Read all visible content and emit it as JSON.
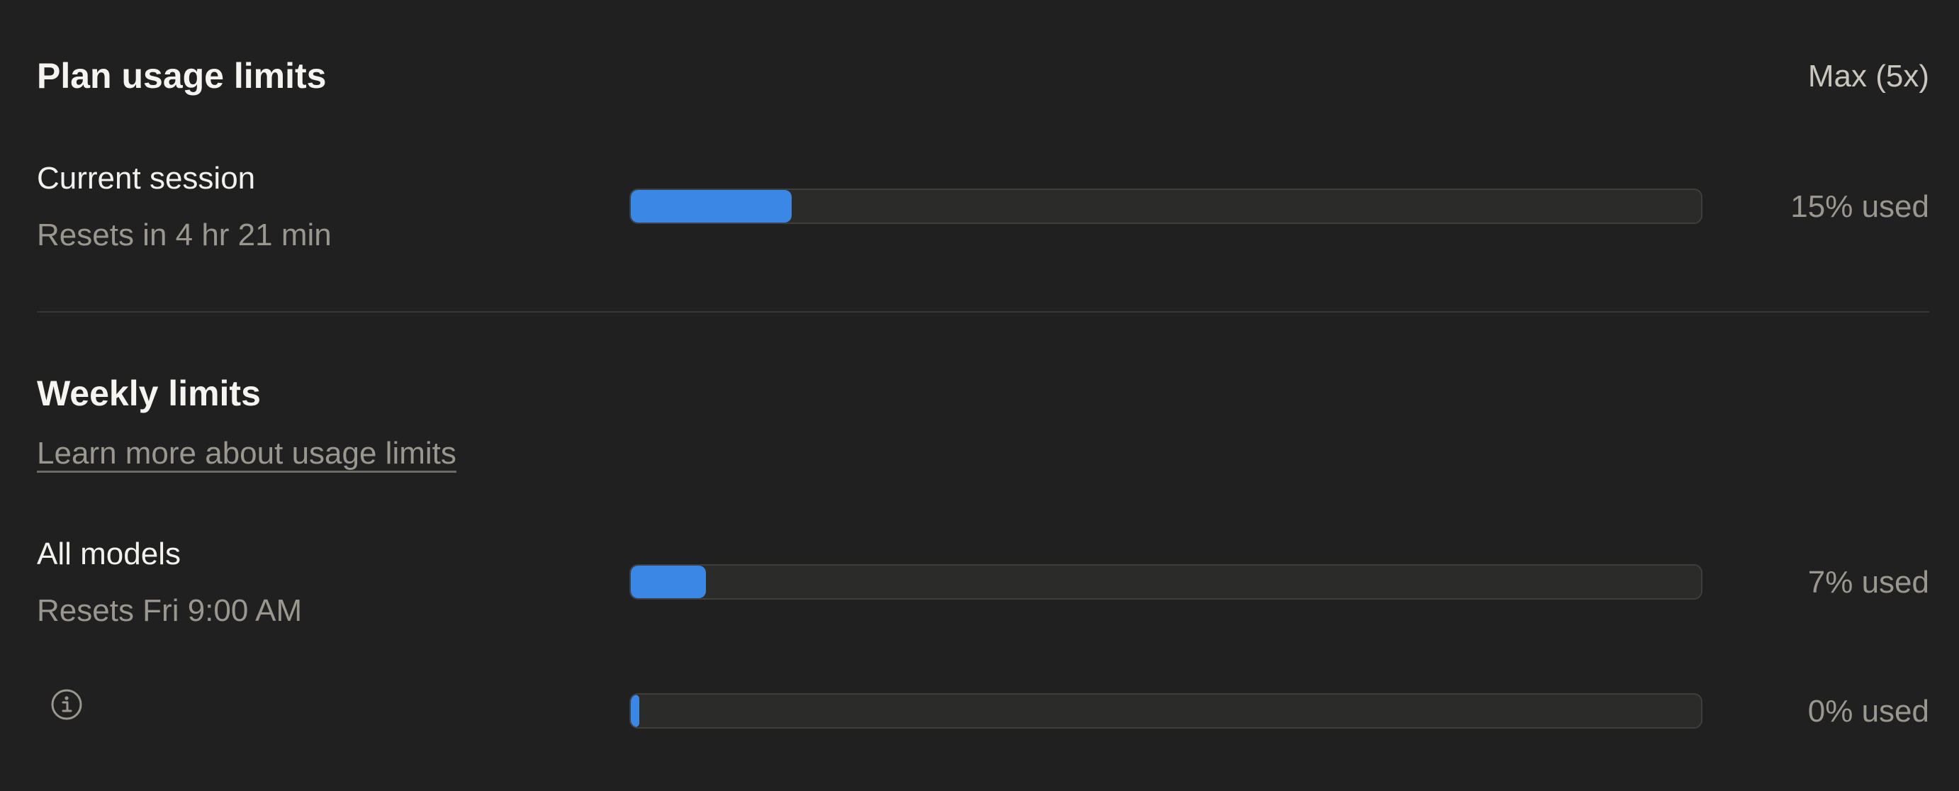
{
  "plan": {
    "title": "Plan usage limits",
    "tier": "Max (5x)"
  },
  "session": {
    "label": "Current session",
    "reset": "Resets in 4 hr 21 min",
    "percent": 15,
    "used_label": "15% used"
  },
  "weekly": {
    "title": "Weekly limits",
    "learn_more": "Learn more about usage limits",
    "rows": [
      {
        "label": "All models",
        "reset": "Resets Fri 9:00 AM",
        "percent": 7,
        "used_label": "7% used"
      },
      {
        "icon": "info-icon",
        "percent": 0,
        "used_label": "0% used"
      }
    ]
  },
  "colors": {
    "background": "#202020",
    "accent": "#3b87e6",
    "track": "#2b2b2a"
  }
}
